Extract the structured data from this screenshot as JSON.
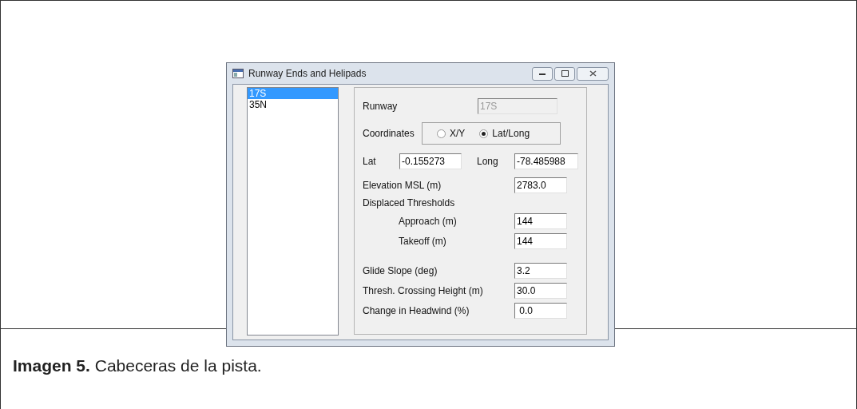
{
  "window": {
    "title": "Runway Ends and Helipads"
  },
  "runway_list": [
    {
      "label": "17S",
      "selected": true
    },
    {
      "label": "35N",
      "selected": false
    }
  ],
  "form": [
    {
      "kind": "field",
      "label": "Runway",
      "value": "17S",
      "disabled": true
    },
    {
      "kind": "radio",
      "label": "Coordinates",
      "options": [
        {
          "label": "X/Y",
          "selected": false
        },
        {
          "label": "Lat/Long",
          "selected": true
        }
      ]
    },
    {
      "kind": "pair",
      "fields": [
        {
          "label": "Lat",
          "value": "-0.155273"
        },
        {
          "label": "Long",
          "value": "-78.485988"
        }
      ]
    },
    {
      "kind": "field",
      "label": "Elevation MSL (m)",
      "value": "2783.0",
      "disabled": false
    },
    {
      "kind": "heading",
      "label": "Displaced Thresholds"
    },
    {
      "kind": "field",
      "label": "Approach (m)",
      "value": "144",
      "disabled": false,
      "indent": true
    },
    {
      "kind": "field",
      "label": "Takeoff (m)",
      "value": "144",
      "disabled": false,
      "indent": true
    },
    {
      "kind": "field",
      "label": "Glide Slope (deg)",
      "value": "3.2",
      "disabled": false
    },
    {
      "kind": "field",
      "label": "Thresh. Crossing Height (m)",
      "value": "30.0",
      "disabled": false
    },
    {
      "kind": "field",
      "label": "Change in Headwind (%)",
      "value": " 0.0",
      "disabled": false
    }
  ],
  "caption": "**Imagen 5.** Cabeceras de la pista."
}
